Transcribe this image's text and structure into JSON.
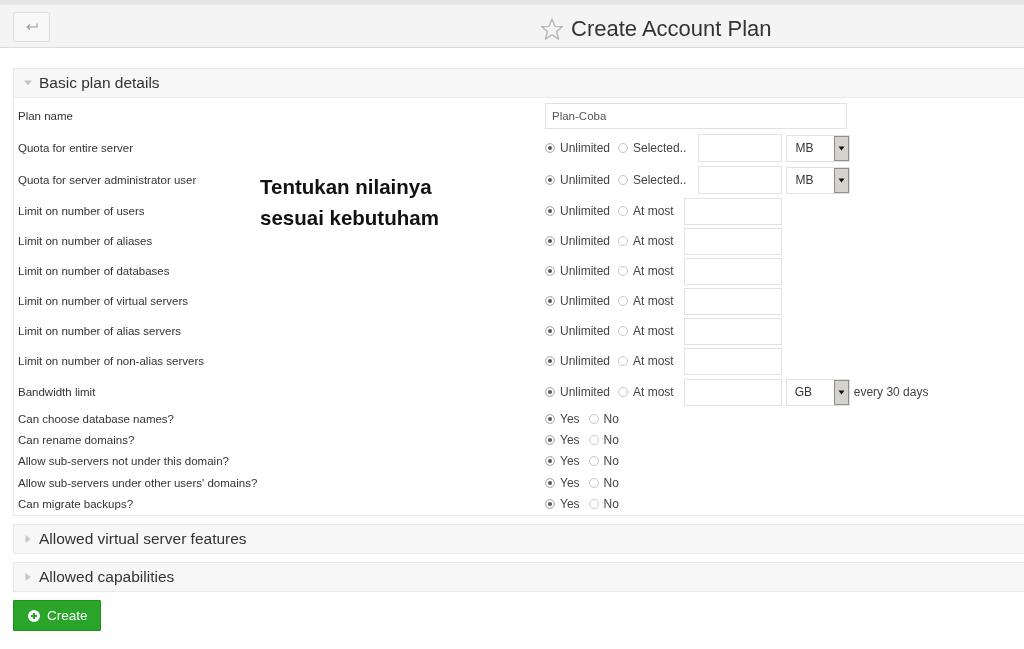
{
  "header": {
    "title": "Create Account Plan"
  },
  "sections": [
    {
      "title": "Basic plan details",
      "expanded": true,
      "fields": [
        {
          "label": "Plan name",
          "kind": "text",
          "value": "Plan-Coba"
        },
        {
          "label": "Quota for entire server",
          "kind": "quota",
          "options": [
            {
              "label": "Unlimited",
              "selected": true
            },
            {
              "label": "Selected..",
              "selected": false
            }
          ],
          "unit": "MB"
        },
        {
          "label": "Quota for server administrator user",
          "kind": "quota",
          "options": [
            {
              "label": "Unlimited",
              "selected": true
            },
            {
              "label": "Selected..",
              "selected": false
            }
          ],
          "unit": "MB"
        },
        {
          "label": "Limit on number of users",
          "kind": "limit",
          "options": [
            {
              "label": "Unlimited",
              "selected": true
            },
            {
              "label": "At most",
              "selected": false
            }
          ]
        },
        {
          "label": "Limit on number of aliases",
          "kind": "limit",
          "options": [
            {
              "label": "Unlimited",
              "selected": true
            },
            {
              "label": "At most",
              "selected": false
            }
          ]
        },
        {
          "label": "Limit on number of databases",
          "kind": "limit",
          "options": [
            {
              "label": "Unlimited",
              "selected": true
            },
            {
              "label": "At most",
              "selected": false
            }
          ]
        },
        {
          "label": "Limit on number of virtual servers",
          "kind": "limit",
          "options": [
            {
              "label": "Unlimited",
              "selected": true
            },
            {
              "label": "At most",
              "selected": false
            }
          ]
        },
        {
          "label": "Limit on number of alias servers",
          "kind": "limit",
          "options": [
            {
              "label": "Unlimited",
              "selected": true
            },
            {
              "label": "At most",
              "selected": false
            }
          ]
        },
        {
          "label": "Limit on number of non-alias servers",
          "kind": "limit",
          "options": [
            {
              "label": "Unlimited",
              "selected": true
            },
            {
              "label": "At most",
              "selected": false
            }
          ]
        },
        {
          "label": "Bandwidth limit",
          "kind": "bandwidth",
          "options": [
            {
              "label": "Unlimited",
              "selected": true
            },
            {
              "label": "At most",
              "selected": false
            }
          ],
          "unit": "GB",
          "suffix": "every 30 days"
        },
        {
          "label": "Can choose database names?",
          "kind": "yesno",
          "options": [
            {
              "label": "Yes",
              "selected": true
            },
            {
              "label": "No",
              "selected": false
            }
          ]
        },
        {
          "label": "Can rename domains?",
          "kind": "yesno",
          "options": [
            {
              "label": "Yes",
              "selected": true
            },
            {
              "label": "No",
              "selected": false
            }
          ]
        },
        {
          "label": "Allow sub-servers not under this domain?",
          "kind": "yesno",
          "options": [
            {
              "label": "Yes",
              "selected": true
            },
            {
              "label": "No",
              "selected": false
            }
          ]
        },
        {
          "label": "Allow sub-servers under other users' domains?",
          "kind": "yesno",
          "options": [
            {
              "label": "Yes",
              "selected": true
            },
            {
              "label": "No",
              "selected": false
            }
          ]
        },
        {
          "label": "Can migrate backups?",
          "kind": "yesno",
          "options": [
            {
              "label": "Yes",
              "selected": true
            },
            {
              "label": "No",
              "selected": false
            }
          ]
        }
      ]
    },
    {
      "title": "Allowed virtual server features",
      "expanded": false
    },
    {
      "title": "Allowed capabilities",
      "expanded": false
    }
  ],
  "annotation": "Tentukan nilainya sesuai kebutuham",
  "create_button": {
    "label": "Create"
  }
}
